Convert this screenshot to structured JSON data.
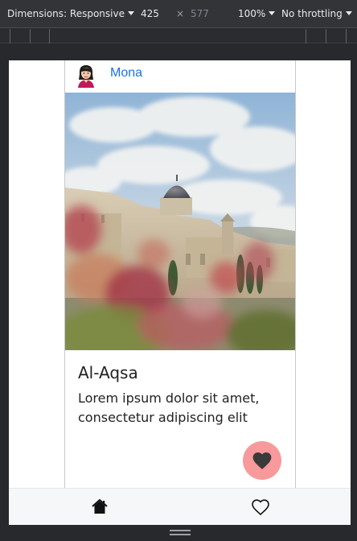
{
  "devtools": {
    "dimensions_label": "Dimensions: Responsive",
    "width_value": "425",
    "times_sign": "×",
    "height_value": "577",
    "zoom": "100%",
    "throttling": "No throttling"
  },
  "card": {
    "username": "Mona",
    "title": "Al-Aqsa",
    "text": "Lorem ipsum dolor sit amet, consectetur adipiscing elit",
    "photo_icon": "al-aqsa-photo",
    "like_icon": "heart-filled-icon"
  },
  "nav": {
    "home_icon": "home-icon",
    "favorites_icon": "heart-outline-icon"
  },
  "colors": {
    "link": "#1a73e8",
    "fab": "#f8999b",
    "nav_bg": "#f6f7f9"
  }
}
